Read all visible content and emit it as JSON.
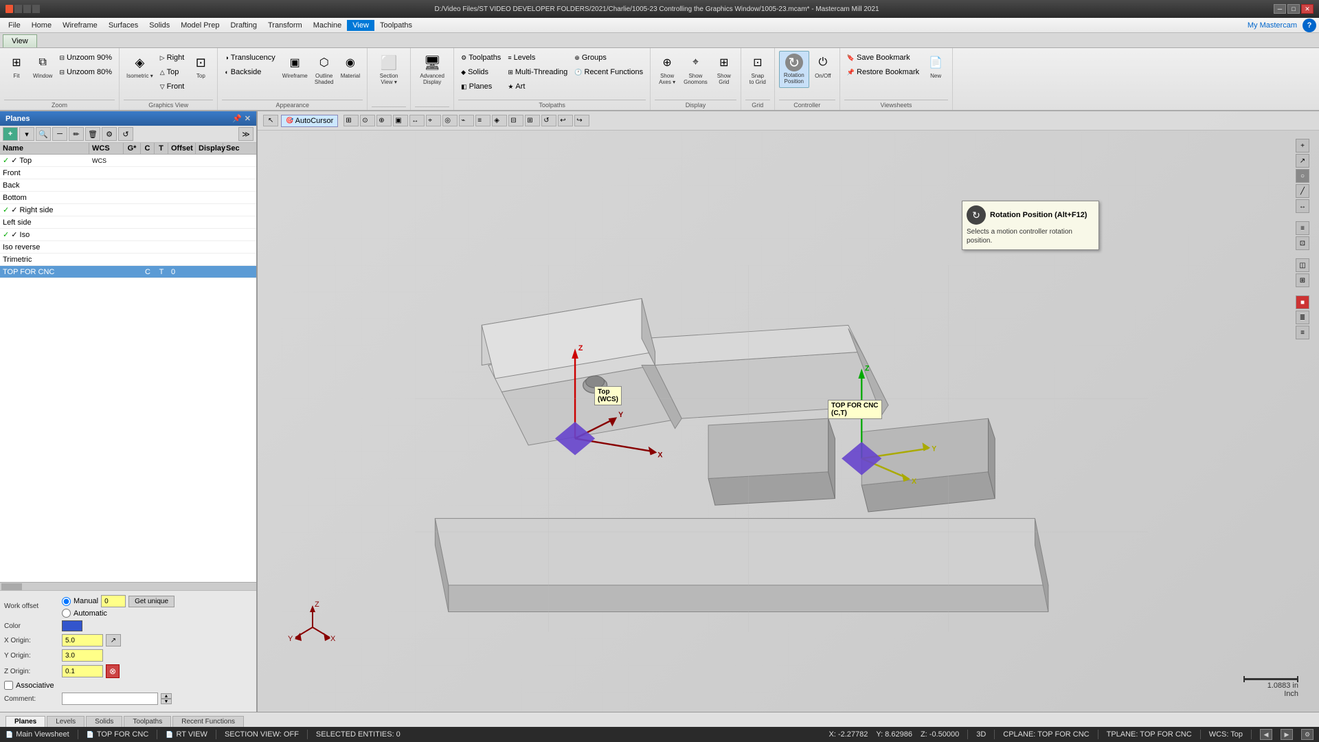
{
  "titlebar": {
    "title": "D:/Video Files/ST VIDEO DEVELOPER FOLDERS/2021/Charlie/1005-23 Controlling the Graphics Window/1005-23.mcam* - Mastercam Mill 2021",
    "app": "Mastercam"
  },
  "menu": {
    "items": [
      "File",
      "Home",
      "Wireframe",
      "Surfaces",
      "Solids",
      "Model Prep",
      "Drafting",
      "Transform",
      "Machine",
      "View",
      "Toolpaths"
    ],
    "active": "View"
  },
  "ribbon": {
    "zoom_group": {
      "label": "Zoom",
      "fit_btn": "Fit",
      "window_btn": "Window",
      "unzoom90_btn": "Unzoom 90%",
      "unzoom80_btn": "Unzoom 80%"
    },
    "view_group": {
      "label": "Graphics View",
      "isometric_btn": "Isometric",
      "right_btn": "Right",
      "top_btn": "Top",
      "front_btn": "Front",
      "top_view_btn": "Top"
    },
    "appearance_group": {
      "label": "Appearance",
      "translucency_btn": "Translucency",
      "backside_btn": "Backside",
      "wireframe_btn": "Wireframe",
      "outline_btn": "Outline Shaded",
      "material_btn": "Material"
    },
    "section_view": {
      "label": "Section View",
      "btn": "Section View"
    },
    "advanced_display": {
      "label": "Advanced Display",
      "btn": "Advanced Display"
    },
    "toolpaths_group": {
      "label": "Toolpaths",
      "toolpaths_btn": "Toolpaths",
      "levels_btn": "Levels",
      "groups_btn": "Groups",
      "solids_btn": "Solids",
      "multi_threading_btn": "Multi-Threading",
      "recent_functions_btn": "Recent Functions",
      "planes_btn": "Planes",
      "art_btn": "Art"
    },
    "display_group": {
      "label": "Display",
      "show_axes_btn": "Show Axes",
      "show_gnomons_btn": "Show Gnomons",
      "show_grid_btn": "Show Grid"
    },
    "grid_group": {
      "label": "Grid",
      "snap_to_grid_btn": "Snap to Grid"
    },
    "controller_group": {
      "label": "Controller",
      "rotation_position_btn": "Rotation Position",
      "on_off_btn": "On/Off"
    },
    "viewsheets_group": {
      "label": "Viewsheets",
      "new_btn": "New",
      "save_bookmark_btn": "Save Bookmark",
      "restore_bookmark_btn": "Restore Bookmark"
    }
  },
  "panel": {
    "title": "Planes",
    "columns": [
      "Name",
      "WCS",
      "G*",
      "C",
      "T",
      "Offset",
      "Display",
      "Sec"
    ],
    "planes": [
      {
        "name": "Top",
        "wcs": "WCS",
        "checked": true,
        "selected": false,
        "g": "",
        "c": "",
        "t": "",
        "offset": "",
        "display": "",
        "sec": ""
      },
      {
        "name": "Front",
        "wcs": "",
        "checked": false,
        "selected": false
      },
      {
        "name": "Back",
        "wcs": "",
        "checked": false,
        "selected": false
      },
      {
        "name": "Bottom",
        "wcs": "",
        "checked": false,
        "selected": false
      },
      {
        "name": "Right side",
        "wcs": "",
        "checked": true,
        "selected": false
      },
      {
        "name": "Left side",
        "wcs": "",
        "checked": false,
        "selected": false
      },
      {
        "name": "Iso",
        "wcs": "",
        "checked": true,
        "selected": false
      },
      {
        "name": "Iso reverse",
        "wcs": "",
        "checked": false,
        "selected": false
      },
      {
        "name": "Trimetric",
        "wcs": "",
        "checked": false,
        "selected": false
      },
      {
        "name": "TOP FOR CNC",
        "wcs": "",
        "checked": false,
        "selected": true,
        "g": "",
        "c": "C",
        "t": "T",
        "offset": "0",
        "display": "",
        "sec": ""
      }
    ],
    "work_offset": {
      "label": "Work offset",
      "manual_label": "Manual",
      "automatic_label": "Automatic",
      "value": "0",
      "get_unique_label": "Get unique"
    },
    "color": {
      "label": "Color"
    },
    "x_origin": {
      "label": "X Origin:",
      "value": "5.0"
    },
    "y_origin": {
      "label": "Y Origin:",
      "value": "3.0"
    },
    "z_origin": {
      "label": "Z Origin:",
      "value": "0.1"
    },
    "associative_label": "Associative",
    "comment_label": "Comment:"
  },
  "viewport": {
    "toolbar_items": [
      "AutoCursor"
    ],
    "plane_label": "Top\n(WCS)",
    "cnc_label": "TOP FOR CNC\n(C,T)"
  },
  "tooltip": {
    "title": "Rotation Position (Alt+F12)",
    "description": "Selects a motion controller rotation position."
  },
  "bottom_tabs": {
    "tabs": [
      "Planes",
      "Levels",
      "Solids",
      "Toolpaths",
      "Recent Functions"
    ]
  },
  "status_bar": {
    "viewsheet": "Main Viewsheet",
    "top_for_cnc": "TOP FOR CNC",
    "rt_view": "RT VIEW",
    "section_view": "SECTION VIEW: OFF",
    "selected": "SELECTED ENTITIES: 0",
    "x": "X: -2.27782",
    "y": "Y: 8.62986",
    "z": "Z: -0.50000",
    "dim": "3D",
    "cplane": "CPLANE: TOP FOR CNC",
    "tplane": "TPLANE: TOP FOR CNC",
    "wcs": "WCS: Top"
  },
  "scale": {
    "value": "1.0883 in",
    "unit": "Inch"
  }
}
